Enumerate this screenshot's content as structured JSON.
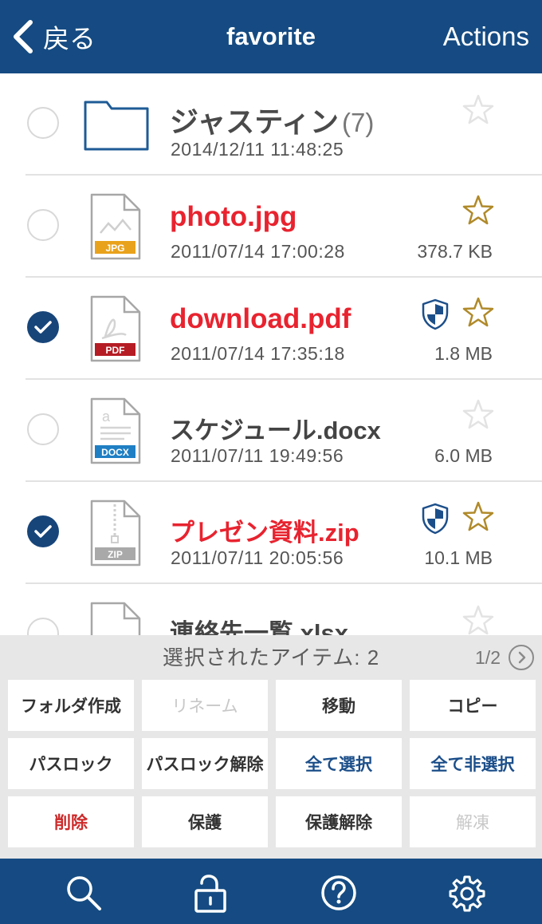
{
  "nav": {
    "back_label": "戻る",
    "title": "favorite",
    "actions_label": "Actions"
  },
  "files": [
    {
      "name": "ジャスティン",
      "count": "(7)",
      "date": "2014/12/11 11:48:25",
      "size": "",
      "type": "folder",
      "selected": false,
      "starred": false,
      "protected": false
    },
    {
      "name": "photo.jpg",
      "type_badge": "JPG",
      "date": "2011/07/14 17:00:28",
      "size": "378.7 KB",
      "selected": false,
      "starred": true,
      "protected": false
    },
    {
      "name": "download.pdf",
      "type_badge": "PDF",
      "date": "2011/07/14 17:35:18",
      "size": "1.8 MB",
      "selected": true,
      "starred": true,
      "protected": true
    },
    {
      "name": "スケジュール.docx",
      "type_badge": "DOCX",
      "date": "2011/07/11 19:49:56",
      "size": "6.0 MB",
      "selected": false,
      "starred": false,
      "protected": false
    },
    {
      "name": "プレゼン資料.zip",
      "type_badge": "ZIP",
      "date": "2011/07/11 20:05:56",
      "size": "10.1 MB",
      "selected": true,
      "starred": true,
      "protected": true
    },
    {
      "name": "連絡先一覧.xlsx",
      "selected": false,
      "starred": false,
      "protected": false
    }
  ],
  "selection": {
    "label": "選択されたアイテム: 2",
    "page": "1/2"
  },
  "actions": [
    {
      "label": "フォルダ作成",
      "state": "normal"
    },
    {
      "label": "リネーム",
      "state": "disabled"
    },
    {
      "label": "移動",
      "state": "normal"
    },
    {
      "label": "コピー",
      "state": "normal"
    },
    {
      "label": "パスロック",
      "state": "normal"
    },
    {
      "label": "パスロック解除",
      "state": "normal"
    },
    {
      "label": "全て選択",
      "state": "highlight"
    },
    {
      "label": "全て非選択",
      "state": "highlight"
    },
    {
      "label": "削除",
      "state": "destructive"
    },
    {
      "label": "保護",
      "state": "normal"
    },
    {
      "label": "保護解除",
      "state": "normal"
    },
    {
      "label": "解凍",
      "state": "disabled"
    }
  ],
  "tabs": [
    {
      "icon": "search-icon"
    },
    {
      "icon": "unlock-icon"
    },
    {
      "icon": "help-icon"
    },
    {
      "icon": "settings-gear-icon"
    }
  ],
  "colors": {
    "nav_bar": "#154b82",
    "filename_red": "#e8232f",
    "checkbox_selected": "#17457a",
    "star_gold": "#b08a2a",
    "jpg_badge": "#e9a21c",
    "pdf_badge": "#b51c24",
    "docx_badge": "#1f7fc4",
    "zip_badge": "#a9a9a9"
  }
}
